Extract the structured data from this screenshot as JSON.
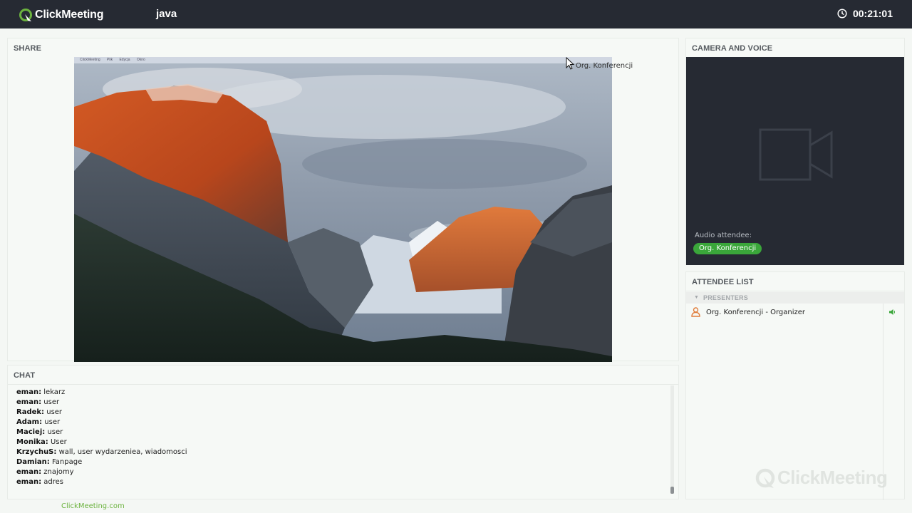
{
  "header": {
    "logo_text": "ClickMeeting",
    "room_name": "java",
    "timer": "00:21:01"
  },
  "colors": {
    "topbar": "#262a33",
    "accent_green": "#3aa63a",
    "link_green": "#6cb33f"
  },
  "share": {
    "title": "SHARE",
    "cursor_label": "Org. Konferencji",
    "screen_menu": [
      "ClickMeeting",
      "Plik",
      "Edycja",
      "Okno"
    ]
  },
  "chat": {
    "title": "CHAT",
    "messages": [
      {
        "author": "eman:",
        "text": "lekarz"
      },
      {
        "author": "eman:",
        "text": "user"
      },
      {
        "author": "Radek:",
        "text": "user"
      },
      {
        "author": "Adam:",
        "text": "user"
      },
      {
        "author": "Maciej:",
        "text": "user"
      },
      {
        "author": "Monika:",
        "text": "User"
      },
      {
        "author": "KrzychuS:",
        "text": "wall, user wydarzeniea, wiadomosci"
      },
      {
        "author": "Damian:",
        "text": "Fanpage"
      },
      {
        "author": "eman:",
        "text": "znajomy"
      },
      {
        "author": "eman:",
        "text": "adres"
      }
    ]
  },
  "footer": {
    "link": "ClickMeeting.com"
  },
  "camera": {
    "title": "CAMERA AND VOICE",
    "audio_label": "Audio attendee:",
    "audio_user": "Org. Konferencji",
    "icon": "video-camera-icon"
  },
  "attendees": {
    "title": "ATTENDEE LIST",
    "group_label": "PRESENTERS",
    "list": [
      {
        "name": "Org. Konferencji - Organizer",
        "icon": "user-icon",
        "status_icon": "speaker-icon"
      }
    ],
    "watermark": "ClickMeeting"
  }
}
